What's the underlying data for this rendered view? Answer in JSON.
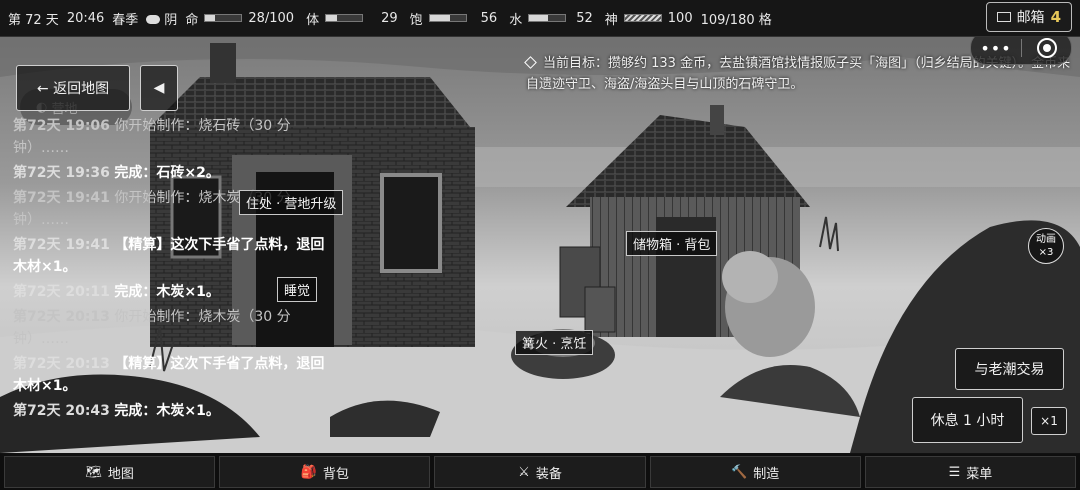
{
  "status": {
    "day": "第 72 天",
    "time": "20:46",
    "season": "春季",
    "weather": "阴",
    "life_label": "命",
    "life_value": "28/100",
    "life_level": 0.28,
    "body_label": "体",
    "body_value": "29",
    "body_level": 0.29,
    "full_label": "饱",
    "full_value": "56",
    "full_level": 0.56,
    "water_label": "水",
    "water_value": "52",
    "water_level": 0.52,
    "spirit_label": "神",
    "spirit_value": "100",
    "spirit_level": 1.0,
    "capacity": "109/180 格"
  },
  "mailbox": {
    "label": "邮箱",
    "count": "4"
  },
  "goal": {
    "text": "当前目标：攒够约 133 金币，去盐镇酒馆找情报贩子买「海图」（归乡结局的关键）。金币来自遗迹守卫、海盗/海盗头目与山顶的石碑守卫。"
  },
  "controls": {
    "back_map": "← 返回地图",
    "back_arrow": "◀",
    "mini_label": "营地",
    "anim_label": "动画",
    "anim_mult": "×3"
  },
  "scene_tags": {
    "residence": "住处 · 营地升级",
    "sleep": "睡觉",
    "storage": "储物箱 · 背包",
    "fire": "篝火 · 烹饪"
  },
  "actions": {
    "trade": "与老潮交易",
    "rest": "休息 1 小时",
    "rest_mult": "×1"
  },
  "log": [
    {
      "ts": "第72天 19:06",
      "text": "你开始制作：烧石砖（30 分钟）……",
      "style": "fade"
    },
    {
      "ts": "第72天 19:36",
      "text": "完成：石砖×2。",
      "style": "bold"
    },
    {
      "ts": "第72天 19:41",
      "text": "你开始制作：烧木炭（30 分钟）……",
      "style": "fade"
    },
    {
      "ts": "第72天 19:41",
      "text": "【精算】这次下手省了点料，退回 木材×1。",
      "style": "bold"
    },
    {
      "ts": "第72天 20:11",
      "text": "完成：木炭×1。",
      "style": "bold"
    },
    {
      "ts": "第72天 20:13",
      "text": "你开始制作：烧木炭（30 分钟）……",
      "style": "fade"
    },
    {
      "ts": "第72天 20:13",
      "text": "【精算】这次下手省了点料，退回 木材×1。",
      "style": "bold"
    },
    {
      "ts": "第72天 20:43",
      "text": "完成：木炭×1。",
      "style": "bold"
    }
  ],
  "nav": [
    {
      "icon": "map-icon",
      "glyph": "🗺",
      "label": "地图"
    },
    {
      "icon": "backpack-icon",
      "glyph": "🎒",
      "label": "背包"
    },
    {
      "icon": "swords-icon",
      "glyph": "⚔",
      "label": "装备"
    },
    {
      "icon": "hammer-icon",
      "glyph": "🔨",
      "label": "制造"
    },
    {
      "icon": "menu-icon",
      "glyph": "☰",
      "label": "菜单"
    }
  ]
}
